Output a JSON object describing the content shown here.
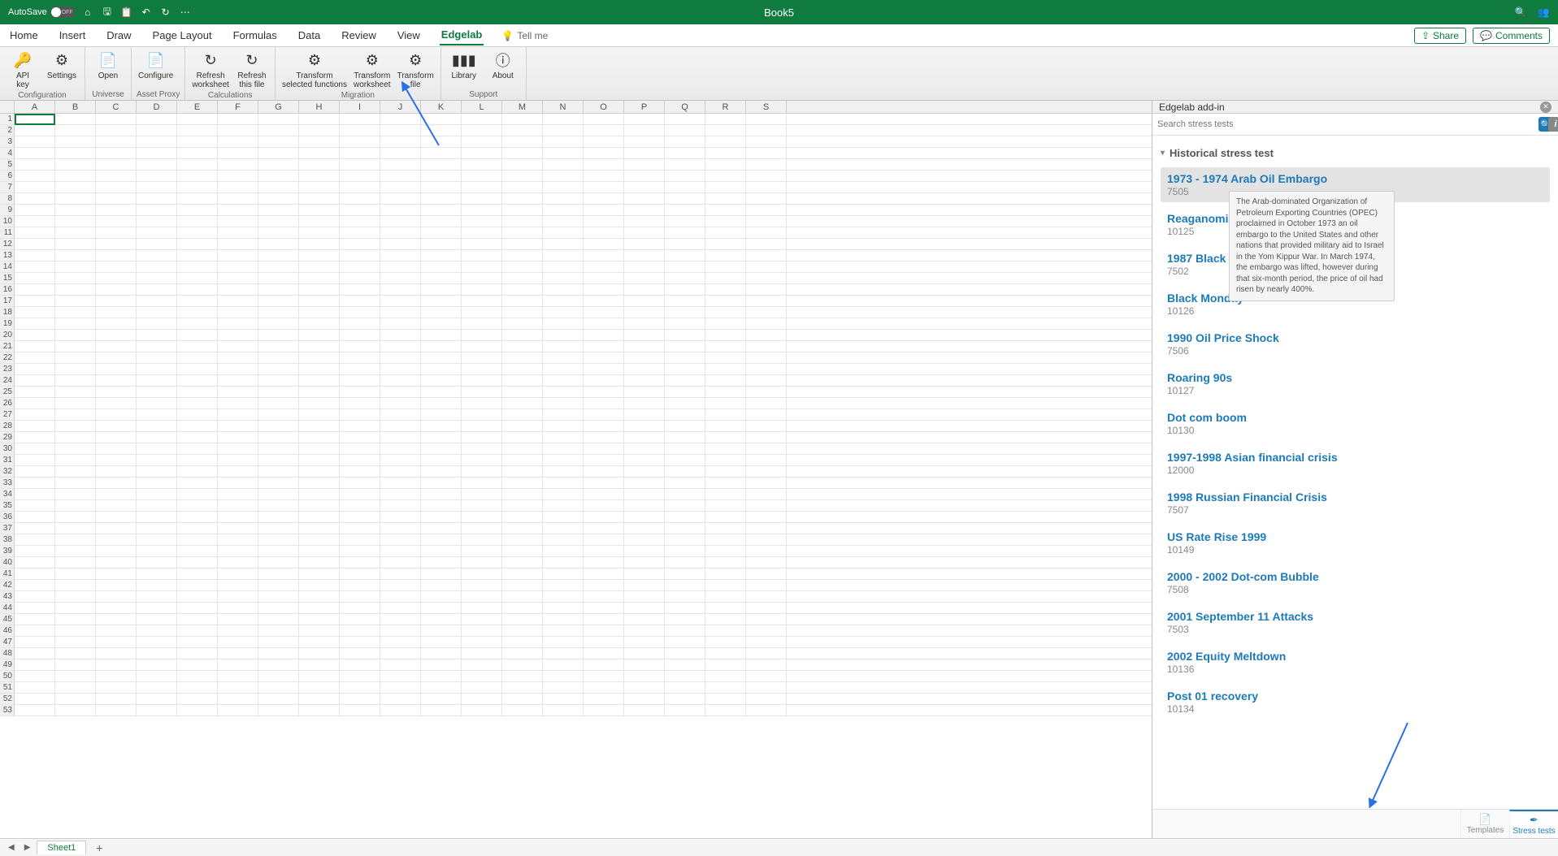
{
  "titlebar": {
    "autosave_label": "AutoSave",
    "autosave_state": "OFF",
    "workbook_title": "Book5"
  },
  "tabs": {
    "items": [
      "Home",
      "Insert",
      "Draw",
      "Page Layout",
      "Formulas",
      "Data",
      "Review",
      "View",
      "Edgelab"
    ],
    "active_index": 8,
    "tell_me": "Tell me",
    "share": "Share",
    "comments": "Comments"
  },
  "ribbon": {
    "groups": [
      {
        "label": "Configuration",
        "items": [
          {
            "icon": "key-icon",
            "glyph": "🔑",
            "label": "API\nkey"
          },
          {
            "icon": "gear-icon",
            "glyph": "⚙",
            "label": "Settings"
          }
        ]
      },
      {
        "label": "Universe",
        "items": [
          {
            "icon": "document-icon",
            "glyph": "📄",
            "label": "Open"
          }
        ]
      },
      {
        "label": "Asset Proxy",
        "items": [
          {
            "icon": "document-gear-icon",
            "glyph": "📄",
            "label": "Configure"
          }
        ]
      },
      {
        "label": "Calculations",
        "items": [
          {
            "icon": "refresh-icon",
            "glyph": "↻",
            "label": "Refresh\nworksheet"
          },
          {
            "icon": "refresh-icon",
            "glyph": "↻",
            "label": "Refresh\nthis file"
          }
        ]
      },
      {
        "label": "Migration",
        "items": [
          {
            "icon": "gear-box-icon",
            "glyph": "⚙",
            "label": "Transform\nselected functions"
          },
          {
            "icon": "gear-box-icon",
            "glyph": "⚙",
            "label": "Transform\nworksheet"
          },
          {
            "icon": "gear-box-icon",
            "glyph": "⚙",
            "label": "Transform\nfile"
          }
        ]
      },
      {
        "label": "Support",
        "items": [
          {
            "icon": "library-icon",
            "glyph": "▮▮▮",
            "label": "Library"
          },
          {
            "icon": "info-icon",
            "glyph": "ⓘ",
            "label": "About"
          }
        ]
      }
    ]
  },
  "grid": {
    "columns": [
      "A",
      "B",
      "C",
      "D",
      "E",
      "F",
      "G",
      "H",
      "I",
      "J",
      "K",
      "L",
      "M",
      "N",
      "O",
      "P",
      "Q",
      "R",
      "S"
    ],
    "rows": 53,
    "selected_cell": "A1"
  },
  "sheet_tabs": {
    "sheets": [
      "Sheet1"
    ]
  },
  "panel": {
    "title": "Edgelab add-in",
    "search_placeholder": "Search stress tests",
    "section_title": "Historical stress test",
    "tooltip_text": "The Arab-dominated Organization of Petroleum Exporting Countries (OPEC) proclaimed in October 1973 an oil embargo to the United States and other nations that provided military aid to Israel in the Yom Kippur War. In March 1974, the embargo was lifted, however during that six-month period, the price of oil had risen by nearly 400%.",
    "items": [
      {
        "title": "1973 - 1974 Arab Oil Embargo",
        "code": "7505",
        "selected": true
      },
      {
        "title": "Reaganomics",
        "code": "10125"
      },
      {
        "title": "1987 Black Mo",
        "code": "7502"
      },
      {
        "title": "Black Monday",
        "code": "10126"
      },
      {
        "title": "1990 Oil Price Shock",
        "code": "7506"
      },
      {
        "title": "Roaring 90s",
        "code": "10127"
      },
      {
        "title": "Dot com boom",
        "code": "10130"
      },
      {
        "title": "1997-1998 Asian financial crisis",
        "code": "12000"
      },
      {
        "title": "1998 Russian Financial Crisis",
        "code": "7507"
      },
      {
        "title": "US Rate Rise 1999",
        "code": "10149"
      },
      {
        "title": "2000 - 2002 Dot-com Bubble",
        "code": "7508"
      },
      {
        "title": "2001 September 11 Attacks",
        "code": "7503"
      },
      {
        "title": "2002 Equity Meltdown",
        "code": "10136"
      },
      {
        "title": "Post 01 recovery",
        "code": "10134"
      }
    ],
    "footer_tabs": [
      {
        "label": "Templates",
        "active": false
      },
      {
        "label": "Stress tests",
        "active": true
      }
    ]
  },
  "colors": {
    "excel_green": "#0f7b3e",
    "link_blue": "#1d7ab8",
    "annotation_blue": "#2a6fe8"
  }
}
